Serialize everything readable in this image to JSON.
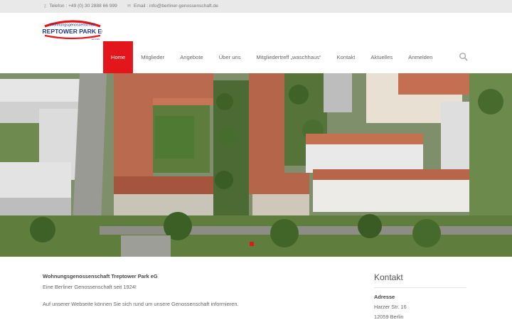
{
  "topbar": {
    "phone": "Telefon : +49 (0) 30 2888 66 999",
    "email": "Email : info@berliner-genossenschaft.de"
  },
  "logo": {
    "line1": "Wohnungsgenossenschaft",
    "line2": "TREPTOWER PARK EG",
    "line3": "seit 1924",
    "brand_color": "#e3171b",
    "text_color": "#1f3a8a"
  },
  "nav": {
    "items": [
      "Home",
      "Mitglieder",
      "Angebote",
      "Über uns",
      "Mitgliedertreff „waschhaus“",
      "Kontakt",
      "Aktuelles",
      "Anmelden"
    ],
    "active_index": 0,
    "search_icon": "search-icon"
  },
  "main": {
    "name": "Wohnungsgenossenschaft Treptower Park eG",
    "subtitle": "Eine Berliner Genossenschaft seit 1924!",
    "info": "Auf unserer Webseite können Sie sich rund um unsere Genossenschaft informieren."
  },
  "sidebar": {
    "title": "Kontakt",
    "address_label": "Adresse",
    "address_lines": [
      "Harzer Str. 16",
      "12059 Berlin"
    ]
  }
}
